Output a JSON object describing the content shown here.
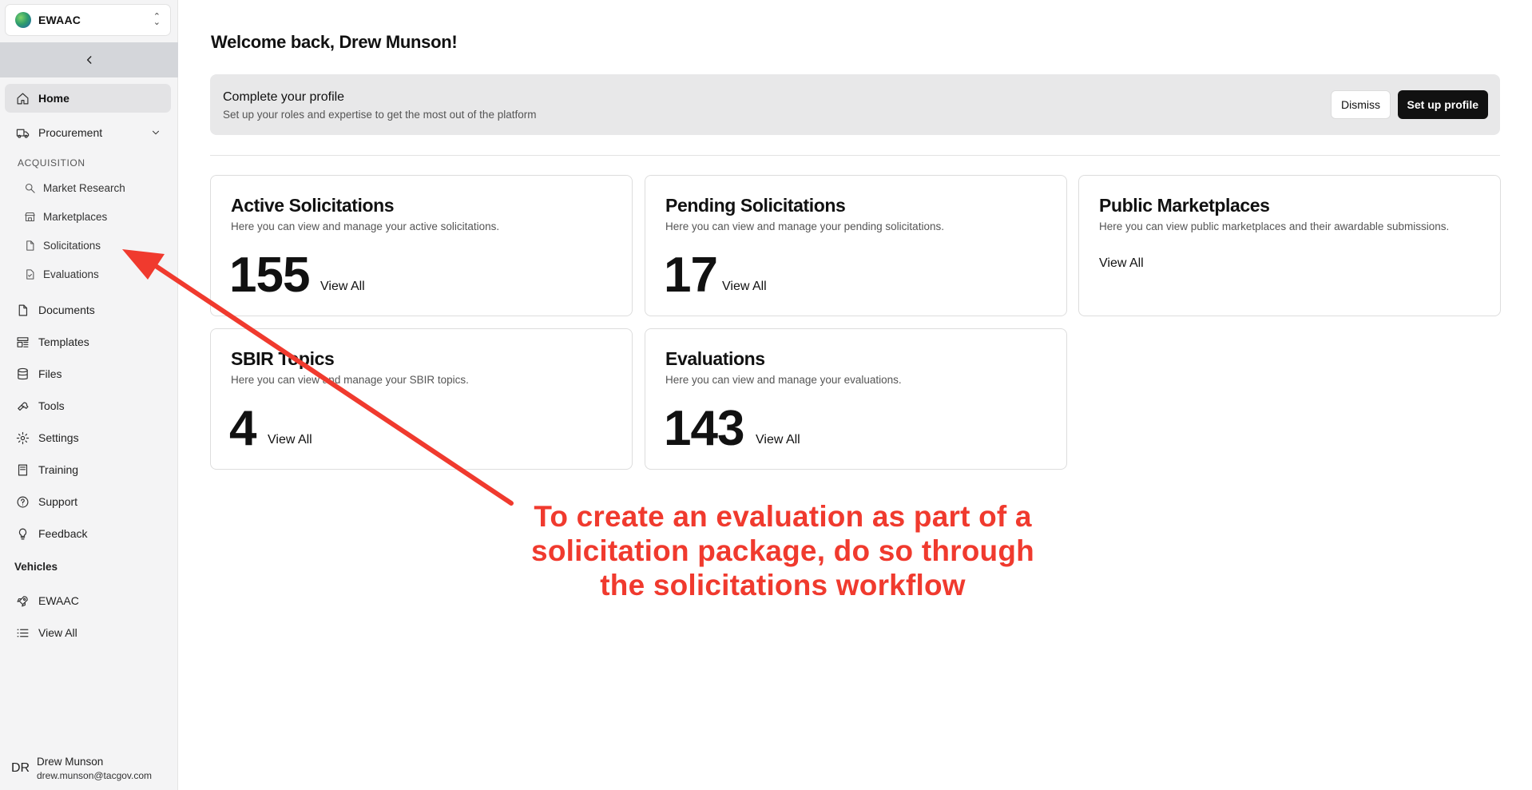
{
  "org": {
    "name": "EWAAC"
  },
  "sidebar": {
    "home": "Home",
    "procurement": "Procurement",
    "acquisition_label": "ACQUISITION",
    "acquisition_items": [
      "Market Research",
      "Marketplaces",
      "Solicitations",
      "Evaluations"
    ],
    "items": [
      "Documents",
      "Templates",
      "Files",
      "Tools",
      "Settings",
      "Training",
      "Support",
      "Feedback"
    ],
    "vehicles_label": "Vehicles",
    "vehicles": [
      "EWAAC",
      "View All"
    ]
  },
  "user": {
    "initials": "DR",
    "name": "Drew Munson",
    "email": "drew.munson@tacgov.com"
  },
  "page": {
    "title": "Welcome back, Drew Munson!"
  },
  "banner": {
    "title": "Complete your profile",
    "subtitle": "Set up your roles and expertise to get the most out of the platform",
    "dismiss": "Dismiss",
    "setup": "Set up profile"
  },
  "cards": [
    {
      "title": "Active Solicitations",
      "desc": "Here you can view and manage your active solicitations.",
      "count": "155",
      "link": "View All"
    },
    {
      "title": "Pending Solicitations",
      "desc": "Here you can view and manage your pending solicitations.",
      "count": "17",
      "link": "View All"
    },
    {
      "title": "Public Marketplaces",
      "desc": "Here you can view public marketplaces and their awardable submissions.",
      "count": "",
      "link": "View All"
    },
    {
      "title": "SBIR Topics",
      "desc": "Here you can view and manage your SBIR topics.",
      "count": "4",
      "link": "View All"
    },
    {
      "title": "Evaluations",
      "desc": "Here you can view and manage your evaluations.",
      "count": "143",
      "link": "View All"
    }
  ],
  "annotation": {
    "lines": [
      "To create an evaluation as part of a",
      "solicitation package, do so through",
      "the solicitations workflow"
    ],
    "color": "#f03a2e"
  }
}
